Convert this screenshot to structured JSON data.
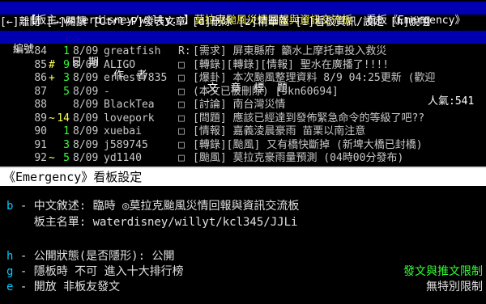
{
  "header": {
    "board_prefix": "【板主:waterdisney/willy..】",
    "board_title": "莫拉克颱風災情回報與資訊交流板",
    "board_label": "看板《Emergency》"
  },
  "keybar": {
    "text": "[←]離開 [→]閱讀 [Ctrl-P]發表文章 [d]刪除 [z]精華區 [i]看板資訊/設定 [h]說明"
  },
  "columns": {
    "num": "編號",
    "date": "日 期",
    "author": "作  者",
    "title": "文  章  標  題",
    "popularity": "人氣:541"
  },
  "articles": [
    {
      "num": "84",
      "mark": "",
      "recommend": "1",
      "rc_color": "g",
      "date": "8/09",
      "author": "greatfish",
      "box": "R:",
      "subject": "[需求] 屏東縣府 籲水上摩托車投入救災",
      "selected": false
    },
    {
      "num": "85",
      "mark": "#",
      "recommend": "9",
      "rc_color": "g",
      "date": "8/09",
      "author": "ALIGO",
      "box": "□",
      "subject": "[轉錄][轉錄][情報] 聖水在廣播了!!!!",
      "selected": false
    },
    {
      "num": "86",
      "mark": "+",
      "recommend": "3",
      "rc_color": "g",
      "date": "8/09",
      "author": "ernest7835",
      "box": "□",
      "subject": "[爆卦] 本次颱風整理資料 8/9 04:25更新 (歡迎",
      "selected": false
    },
    {
      "num": "87",
      "mark": "",
      "recommend": "5",
      "rc_color": "g",
      "date": "8/09",
      "author": "-",
      "box": "□",
      "subject": "(本文已被刪除) [skn60694]",
      "selected": false
    },
    {
      "num": "88",
      "mark": "",
      "recommend": "",
      "rc_color": "g",
      "date": "8/09",
      "author": "BlackTea",
      "box": "□",
      "subject": "[討論] 南台灣災情",
      "selected": false
    },
    {
      "num": "89",
      "mark": "~",
      "recommend": "14",
      "rc_color": "y",
      "date": "8/09",
      "author": "lovepork",
      "box": "□",
      "subject": "[問題] 應該已經達到發佈緊急命令的等級了吧??",
      "selected": false
    },
    {
      "num": "90",
      "mark": "",
      "recommend": "1",
      "rc_color": "g",
      "date": "8/09",
      "author": "xuebai",
      "box": "□",
      "subject": "[情報] 嘉義淩晨豪雨 苗栗以南注意",
      "selected": false
    },
    {
      "num": "91",
      "mark": "",
      "recommend": "3",
      "rc_color": "g",
      "date": "8/09",
      "author": "j589745",
      "box": "□",
      "subject": "[轉錄][颱風] 又有橋快斷掉 (新埤大橋已封橋)",
      "selected": false
    },
    {
      "num": "92",
      "mark": "~",
      "recommend": "5",
      "rc_color": "g",
      "date": "8/09",
      "author": "yd1140",
      "box": "□",
      "subject": "[颱風] 莫拉克豪雨量預測 (04時00分發布)",
      "selected": false
    }
  ],
  "dialog": {
    "title": "《Emergency》看板設定",
    "lines": [
      {
        "key": "b",
        "text": " - 中文敘述: 臨時 ◎莫拉克颱風災情回報與資訊交流板"
      },
      {
        "key": "",
        "text": "    板主名單: waterdisney/willyt/kcl345/JJLi"
      },
      {
        "key": "h",
        "text": " - 公開狀態(是否隱形): 公開"
      },
      {
        "key": "g",
        "text": " - 隱板時 不可 進入十大排行榜"
      },
      {
        "key": "e",
        "text": " - 開放 非板友發文"
      }
    ],
    "right_green": "發文與推文限制",
    "right_white": "無特別限制"
  }
}
